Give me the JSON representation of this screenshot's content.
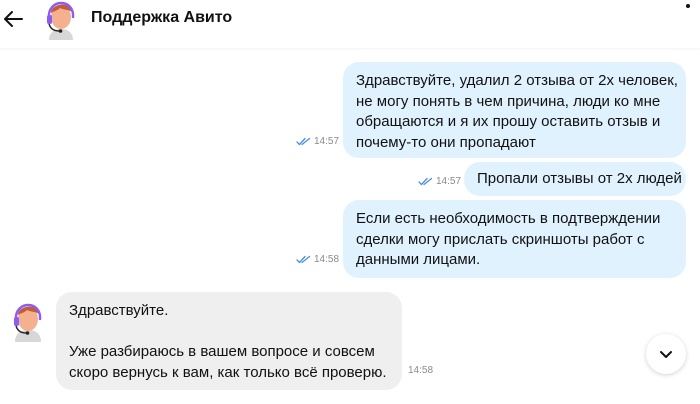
{
  "header": {
    "title": "Поддержка Авито"
  },
  "messages": [
    {
      "direction": "out",
      "lines": [
        "Здравствуйте, удалил 2 отзыва от 2х человек,",
        "не могу понять в чем причина, люди ко мне",
        "обращаются и я их прошу оставить отзыв и",
        "почему-то они пропадают"
      ],
      "time": "14:57",
      "status": "read"
    },
    {
      "direction": "out",
      "lines": [
        "Пропали отзывы от 2х людей"
      ],
      "time": "14:57",
      "status": "read"
    },
    {
      "direction": "out",
      "lines": [
        "Если есть необходимость в подтверждении",
        "сделки могу прислать скриншоты работ с",
        "данными лицами."
      ],
      "time": "14:58",
      "status": "read"
    },
    {
      "direction": "in",
      "lines": [
        "Здравствуйте.",
        "",
        "Уже разбираюсь в вашем вопросе и совсем",
        "скоро вернусь к вам, как только всё проверю."
      ],
      "time": "14:58"
    }
  ],
  "icons": {
    "back": "arrow-left-icon",
    "avatar": "support-agent-avatar",
    "read_status": "double-check-icon",
    "scroll": "chevron-down-icon"
  },
  "colors": {
    "outgoing_bubble": "#e1f2ff",
    "incoming_bubble": "#efefef",
    "check": "#4a90e2",
    "headset": "#8b5cf6"
  }
}
